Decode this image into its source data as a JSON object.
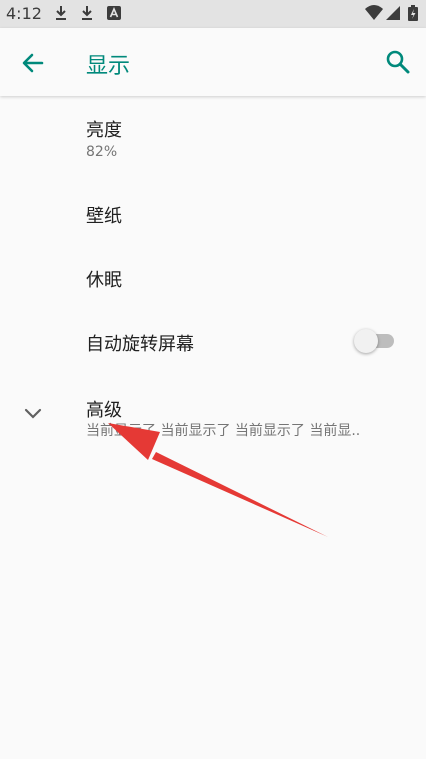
{
  "status_bar": {
    "time": "4:12",
    "icons": [
      "download-icon",
      "download-icon",
      "a-badge-icon",
      "wifi-icon",
      "signal-icon",
      "battery-icon"
    ]
  },
  "app_bar": {
    "title": "显示",
    "back_icon": "arrow-left-icon",
    "search_icon": "search-icon",
    "accent_color": "#00897b"
  },
  "settings": {
    "brightness": {
      "label": "亮度",
      "summary": "82%"
    },
    "wallpaper": {
      "label": "壁纸"
    },
    "sleep": {
      "label": "休眠"
    },
    "auto_rotate": {
      "label": "自动旋转屏幕",
      "enabled": false
    },
    "advanced": {
      "label": "高级",
      "summary": "当前显示了 当前显示了 当前显示了 当前显.."
    }
  },
  "annotation": {
    "type": "red-arrow",
    "color": "#e53935"
  }
}
